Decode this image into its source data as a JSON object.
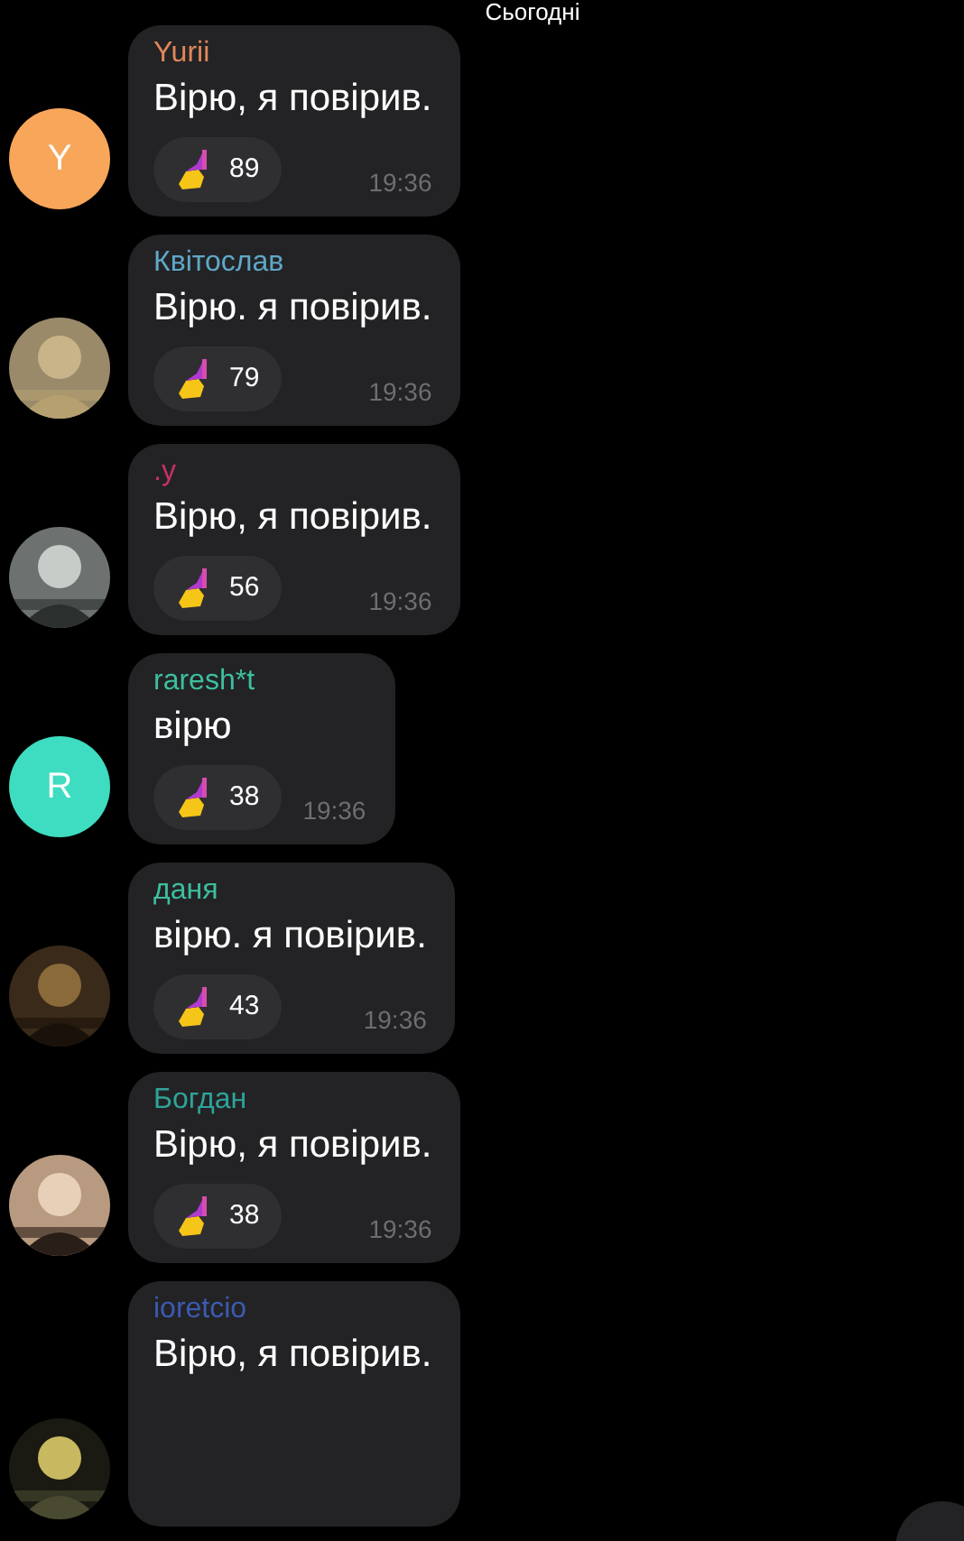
{
  "date_label": "Сьогодні",
  "messages": [
    {
      "author": "Yurii",
      "color": "#e0875a",
      "text": "Вірю, я повірив.",
      "avatar": {
        "kind": "letter",
        "letter": "Y",
        "color": "#f7a65a"
      },
      "reaction_count": "89",
      "time": "19:36"
    },
    {
      "author": "Квітослав",
      "color": "#5fa8c8",
      "text": "Вірю. я повірив.",
      "reaction_count": "79",
      "time": "19:36"
    },
    {
      "author": ".у",
      "color": "#c8306a",
      "text": "Вірю, я повірив.",
      "reaction_count": "56",
      "time": "19:36"
    },
    {
      "author": "raresh*t",
      "color": "#3dbf9f",
      "text": "вірю",
      "avatar": {
        "kind": "letter",
        "letter": "R",
        "color": "#3edcc0"
      },
      "reaction_count": "38",
      "time": "19:36"
    },
    {
      "author": "даня",
      "color": "#3dbf9f",
      "text": "вірю. я повірив.",
      "reaction_count": "43",
      "time": "19:36"
    },
    {
      "author": "Богдан",
      "color": "#2fa39a",
      "text": "Вірю, я повірив.",
      "reaction_count": "38",
      "time": "19:36"
    },
    {
      "author": "ioretcio",
      "color": "#3b5bb0",
      "text": "Вірю, я повірив."
    }
  ]
}
